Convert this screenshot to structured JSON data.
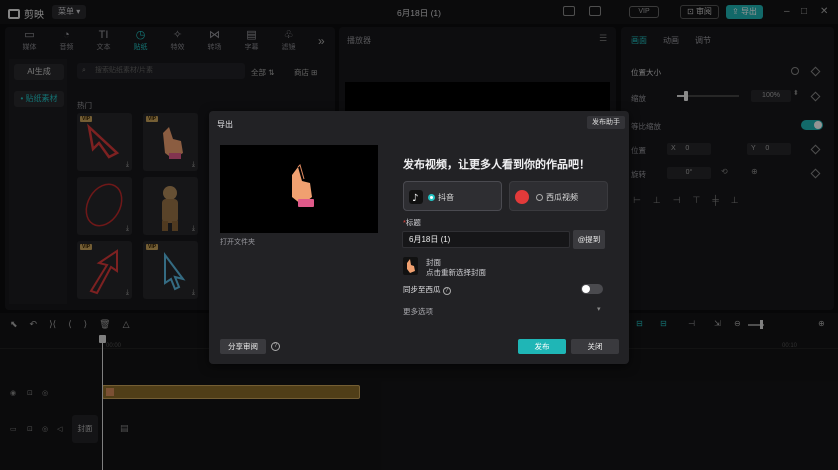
{
  "app": {
    "logo_text": "剪映",
    "menu_label": "菜单",
    "window_title": "6月18日 (1)",
    "vip_label": "VIP",
    "review_label": "审阅",
    "export_label": "导出"
  },
  "left_panel": {
    "tabs": [
      {
        "icon": "▭",
        "label": "媒体"
      },
      {
        "icon": "◔",
        "label": "音频"
      },
      {
        "icon": "TI",
        "label": "文本"
      },
      {
        "icon": "◷",
        "label": "贴纸"
      },
      {
        "icon": "✧",
        "label": "特效"
      },
      {
        "icon": "⋈",
        "label": "转场"
      },
      {
        "icon": "▤",
        "label": "字幕"
      },
      {
        "icon": "♧",
        "label": "滤镜"
      }
    ],
    "sidebar": {
      "ai_label": "AI生成",
      "sticker_label": "• 贴纸素材"
    },
    "search_placeholder": "搜索贴纸素材/片素",
    "filter_all": "全部 ⇅",
    "filter_store": "商店 ⊞",
    "section_hot": "热门",
    "thumbs": [
      {
        "vip": true
      },
      {
        "vip": true
      },
      {
        "vip": false
      },
      {
        "vip": false
      },
      {
        "vip": true
      },
      {
        "vip": true
      }
    ]
  },
  "player": {
    "title": "播放器"
  },
  "right_panel": {
    "tabs": [
      "画面",
      "动画",
      "调节"
    ],
    "uniform_scale": "位置大小",
    "scale_label": "缩放",
    "scale_value": "100%",
    "equal_ratio_label": "等比缩放",
    "position_label": "位置",
    "pos_x_label": "X",
    "pos_x": "0",
    "pos_y_label": "Y",
    "pos_y": "0",
    "rotate_label": "旋转",
    "rotate_value": "0°"
  },
  "timeline": {
    "tick_left": "00:00",
    "tick_right": "00:10",
    "cover_label": "封面"
  },
  "dialog": {
    "title": "导出",
    "assistant_label": "发布助手",
    "open_folder": "打开文件夹",
    "headline": "发布视频，让更多人看到你的作品吧！",
    "platforms": [
      {
        "name": "抖音",
        "selected": true,
        "color": "#111111"
      },
      {
        "name": "西瓜视频",
        "selected": false,
        "color": "#e23a3a"
      }
    ],
    "title_label_star": "*",
    "title_label": "标题",
    "title_value": "6月18日 (1)",
    "mention_label": "@提到",
    "cover_label": "封面",
    "cover_hint": "点击重新选择封面",
    "sync_label": "同步至西瓜",
    "sync_help": "?",
    "more_options": "更多选项",
    "share_review": "分享审阅",
    "help": "?",
    "publish": "发布",
    "close": "关闭"
  }
}
